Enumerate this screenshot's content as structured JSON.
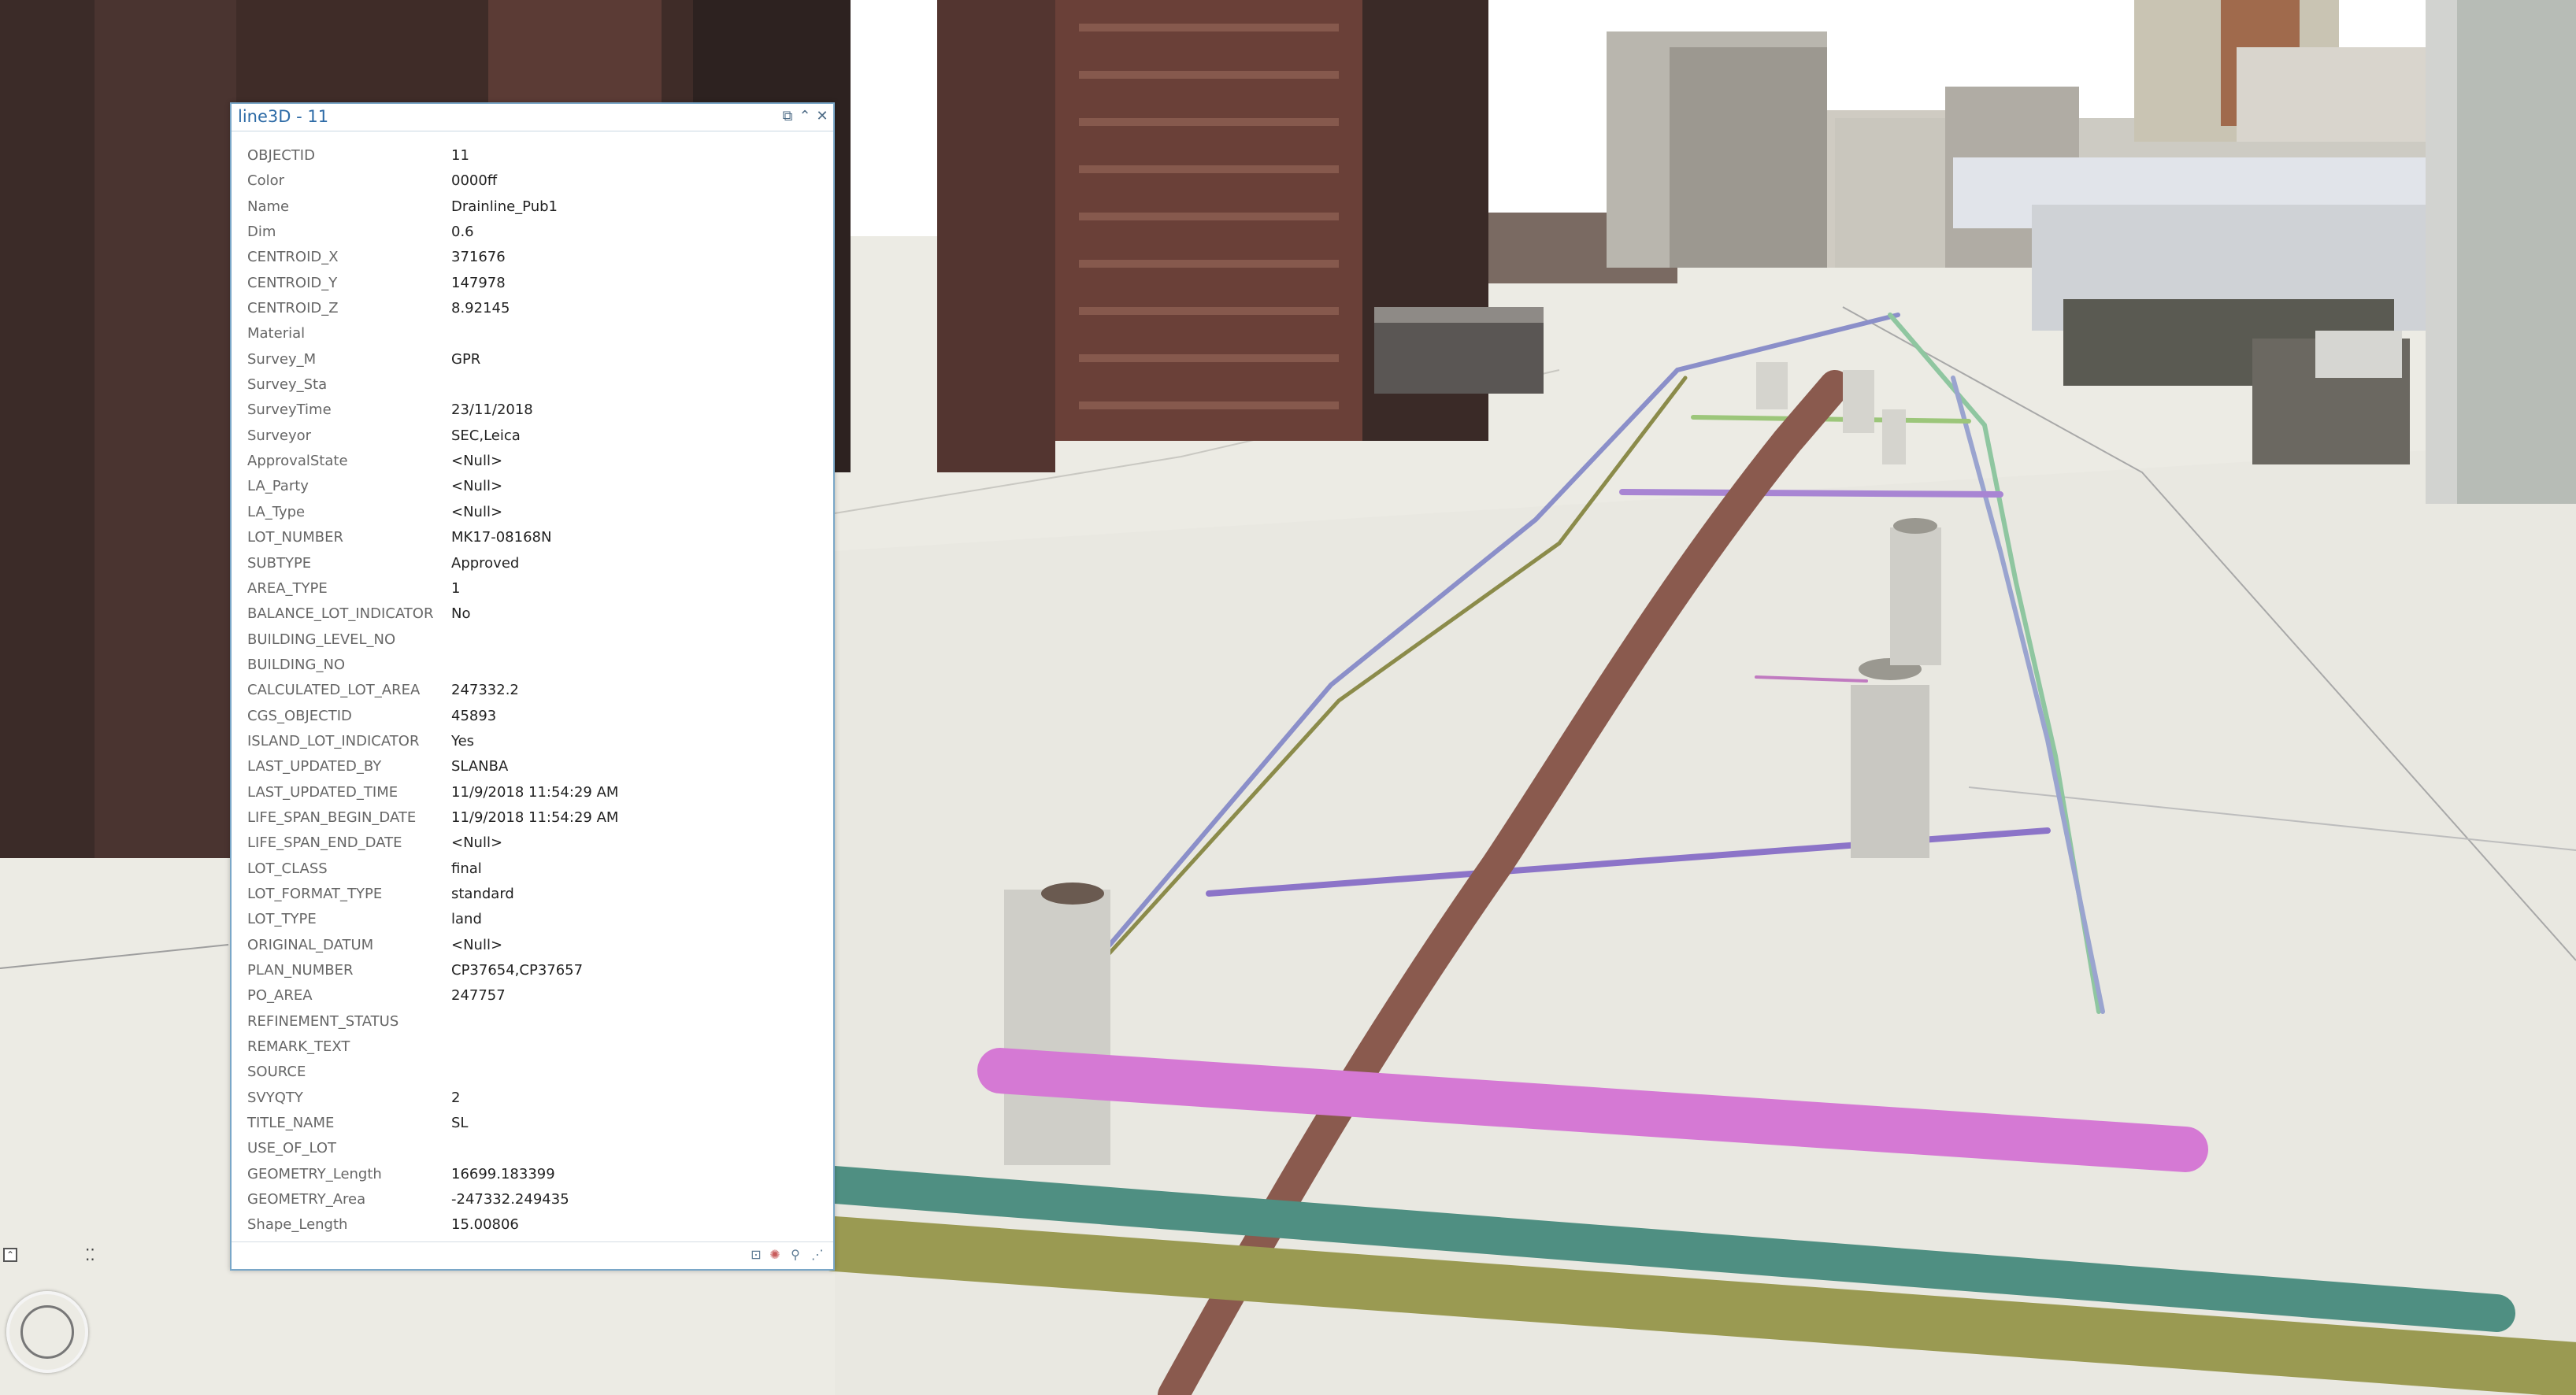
{
  "popup": {
    "title": "line3D - 11",
    "fields": [
      {
        "name": "OBJECTID",
        "value": "11"
      },
      {
        "name": "Color",
        "value": "0000ff"
      },
      {
        "name": "Name",
        "value": "Drainline_Pub1"
      },
      {
        "name": "Dim",
        "value": "0.6"
      },
      {
        "name": "CENTROID_X",
        "value": "371676"
      },
      {
        "name": "CENTROID_Y",
        "value": "147978"
      },
      {
        "name": "CENTROID_Z",
        "value": "8.92145"
      },
      {
        "name": "Material",
        "value": ""
      },
      {
        "name": "Survey_M",
        "value": "GPR"
      },
      {
        "name": "Survey_Sta",
        "value": ""
      },
      {
        "name": "SurveyTime",
        "value": "23/11/2018"
      },
      {
        "name": "Surveyor",
        "value": "SEC,Leica"
      },
      {
        "name": "ApprovalState",
        "value": "<Null>"
      },
      {
        "name": "LA_Party",
        "value": "<Null>"
      },
      {
        "name": "LA_Type",
        "value": "<Null>"
      },
      {
        "name": "LOT_NUMBER",
        "value": "MK17-08168N"
      },
      {
        "name": "SUBTYPE",
        "value": "Approved"
      },
      {
        "name": "AREA_TYPE",
        "value": "1"
      },
      {
        "name": "BALANCE_LOT_INDICATOR",
        "value": "No"
      },
      {
        "name": "BUILDING_LEVEL_NO",
        "value": ""
      },
      {
        "name": "BUILDING_NO",
        "value": ""
      },
      {
        "name": "CALCULATED_LOT_AREA",
        "value": "247332.2"
      },
      {
        "name": "CGS_OBJECTID",
        "value": "45893"
      },
      {
        "name": "ISLAND_LOT_INDICATOR",
        "value": "Yes"
      },
      {
        "name": "LAST_UPDATED_BY",
        "value": "SLANBA"
      },
      {
        "name": "LAST_UPDATED_TIME",
        "value": "11/9/2018 11:54:29 AM"
      },
      {
        "name": "LIFE_SPAN_BEGIN_DATE",
        "value": "11/9/2018 11:54:29 AM"
      },
      {
        "name": "LIFE_SPAN_END_DATE",
        "value": "<Null>"
      },
      {
        "name": "LOT_CLASS",
        "value": "final"
      },
      {
        "name": "LOT_FORMAT_TYPE",
        "value": "standard"
      },
      {
        "name": "LOT_TYPE",
        "value": "land"
      },
      {
        "name": "ORIGINAL_DATUM",
        "value": "<Null>"
      },
      {
        "name": "PLAN_NUMBER",
        "value": "CP37654,CP37657"
      },
      {
        "name": "PO_AREA",
        "value": "247757"
      },
      {
        "name": "REFINEMENT_STATUS",
        "value": ""
      },
      {
        "name": "REMARK_TEXT",
        "value": ""
      },
      {
        "name": "SOURCE",
        "value": ""
      },
      {
        "name": "SVYQTY",
        "value": "2"
      },
      {
        "name": "TITLE_NAME",
        "value": "SL"
      },
      {
        "name": "USE_OF_LOT",
        "value": ""
      },
      {
        "name": "GEOMETRY_Length",
        "value": "16699.183399"
      },
      {
        "name": "GEOMETRY_Area",
        "value": "-247332.249435"
      },
      {
        "name": "Shape_Length",
        "value": "15.00806"
      }
    ]
  },
  "colors": {
    "popup_border": "#7aa7c8",
    "title_text": "#2c6aa6",
    "field_text": "#666666",
    "value_text": "#222222",
    "pipe_brown": "#8a5a4e",
    "pipe_pink": "#d579d4",
    "pipe_teal": "#4f8f82",
    "pipe_olive": "#9a9a52",
    "pipe_purple": "#8c74c8",
    "ground": "#ecebe4"
  },
  "icons": {
    "popout": "popout-icon",
    "collapse": "collapse-icon",
    "close": "close-icon",
    "zoom_to": "zoom-to-icon",
    "flash": "flash-icon",
    "search": "search-icon",
    "resize": "resize-grip-icon",
    "navigator": "navigator-icon"
  }
}
